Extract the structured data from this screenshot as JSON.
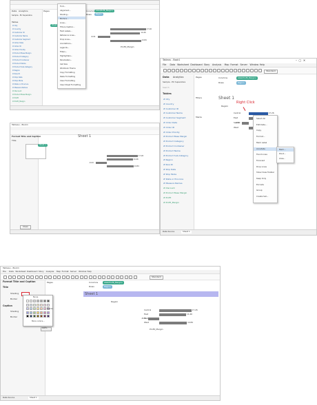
{
  "menu": {
    "items": [
      "File",
      "Data",
      "Worksheet",
      "Dashboard",
      "Story",
      "Analysis",
      "Map",
      "Format",
      "Server",
      "Window",
      "Help"
    ]
  },
  "window": {
    "title": "Tableau - Book1"
  },
  "side_tabs": {
    "data": "Data",
    "analytics": "Analytics"
  },
  "shelves": {
    "columns": "Columns",
    "rows": "Rows",
    "pages": "Pages",
    "filters": "Filters",
    "marks": "Marks",
    "columns_pill": "AGG(Profit_Margin)",
    "rows_pill": "Region"
  },
  "datasource": "Sample - EU Superstore",
  "search_placeholder": "Search",
  "tables_heading": "Tables",
  "fields": [
    "City",
    "Country",
    "Customer ID",
    "Customer Name",
    "Customer Segment",
    "Order Date",
    "Order ID",
    "Order Priority",
    "Product Base Margin",
    "Product Category",
    "Product Container",
    "Product Name",
    "Product Sub-Category",
    "Region",
    "Row ID",
    "Ship Date",
    "Ship Mode",
    "State or Province",
    "Measure Names",
    "Discount",
    "Product Base Margin",
    "Profit",
    "Profit_Margin"
  ],
  "sheet": {
    "title": "Sheet 1",
    "tab": "Sheet 1",
    "datasource_tab": "Data Source",
    "axis_title": "Profit_Margin",
    "region_header": "Region"
  },
  "standard_dropdown": "Standard",
  "chart_data": {
    "type": "bar",
    "categories": [
      "Central",
      "East",
      "South",
      "West"
    ],
    "values": [
      17.26,
      14.46,
      -6.04,
      14.84
    ],
    "value_labels": [
      "17.26",
      "14.46",
      "-6.04",
      "14.84"
    ],
    "xlabel": "Profit_Margin",
    "ylabel": "Region"
  },
  "format_menu": {
    "items": [
      "Font...",
      "Alignment...",
      "Shading...",
      "Borders...",
      "Lines...",
      "Title & Caption...",
      "Field Labels...",
      "Reference Lines...",
      "Drop Lines...",
      "Annotations...",
      "Legends...",
      "Filters...",
      "Highlighters...",
      "Parameters...",
      "Cell Size",
      "Workbook Theme",
      "Copy Formatting",
      "Paste Formatting",
      "Clear Formatting",
      "Clear Sheet Formatting"
    ]
  },
  "context_menu": {
    "items": [
      "Select All",
      "Edit Data...",
      "Copy",
      "Format...",
      "Mark Label",
      "Annotate",
      "Trend Lines",
      "Forecast",
      "Drop Lines",
      "Show View Toolbar",
      "Keep Only",
      "Exclude",
      "Group",
      "Create Set..."
    ],
    "submenu": [
      "Mark...",
      "Point...",
      "Area..."
    ],
    "annotation": "Right Click"
  },
  "format_panel": {
    "title": "Format Title and Caption",
    "title_section": "Title",
    "caption_section": "Caption",
    "shading_label": "Shading",
    "border_label": "Border",
    "none_label": "None",
    "more_colors": "More colors...",
    "clear": "Clear",
    "opacity": "100%"
  },
  "colors": {
    "pill_green": "#3aa88a",
    "pill_blue": "#7bb7d6",
    "bar_grey": "#7c7c7c",
    "bar_selected": "#2b5aa5",
    "title_band": "#b7b7f0",
    "annotation_red": "#d9232d"
  }
}
